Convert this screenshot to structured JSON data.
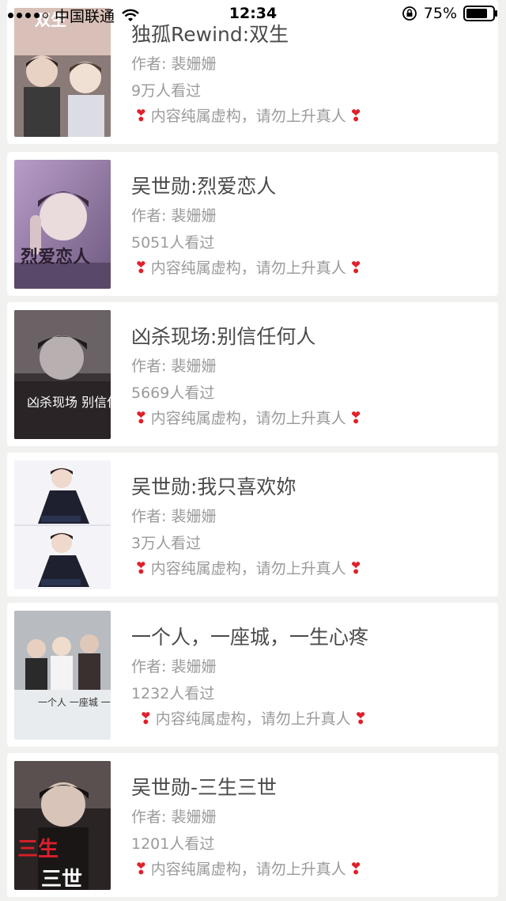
{
  "status_bar": {
    "carrier": "中国联通",
    "time": "12:34",
    "battery": "75%",
    "signal_bars": 4
  },
  "colors": {
    "background": "#f1f1ef",
    "card": "#ffffff",
    "title": "#4a4a4a",
    "meta": "#9a9a9a",
    "heart": "#e0202a"
  },
  "books": [
    {
      "title": "独孤Rewind:双生",
      "author": "作者: 裴姗姗",
      "views": "9万人看过",
      "note": "内容纯属虚构，请勿上升真人",
      "heart": "❣",
      "cover_text": "双生",
      "cover_icon": "two-men-portrait"
    },
    {
      "title": "吴世勋:烈爱恋人",
      "author": "作者: 裴姗姗",
      "views": "5051人看过",
      "note": "内容纯属虚构，请勿上升真人",
      "heart": "❣",
      "cover_text": "烈爱恋人",
      "cover_icon": "portrait-purple"
    },
    {
      "title": "凶杀现场:别信任何人",
      "author": "作者: 裴姗姗",
      "views": "5669人看过",
      "note": "内容纯属虚构，请勿上升真人",
      "heart": "❣",
      "cover_text": "凶杀现场 别信任何人",
      "cover_icon": "portrait-dark"
    },
    {
      "title": "吴世勋:我只喜欢妳",
      "author": "作者: 裴姗姗",
      "views": "3万人看过",
      "note": "内容纯属虚构，请勿上升真人",
      "heart": "❣",
      "cover_text": "",
      "cover_icon": "portrait-light-double"
    },
    {
      "title": "一个人，一座城，一生心疼",
      "author": "作者: 裴姗姗",
      "views": "1232人看过",
      "note": "内容纯属虚构，请勿上升真人",
      "heart": "❣",
      "cover_text": "一个人 一座城 一生心疼",
      "cover_icon": "group-photo"
    },
    {
      "title": "吴世勋-三生三世",
      "author": "作者: 裴姗姗",
      "views": "1201人看过",
      "note": "内容纯属虚构，请勿上升真人",
      "heart": "❣",
      "cover_text": "三生 三世",
      "cover_icon": "portrait-red"
    }
  ]
}
